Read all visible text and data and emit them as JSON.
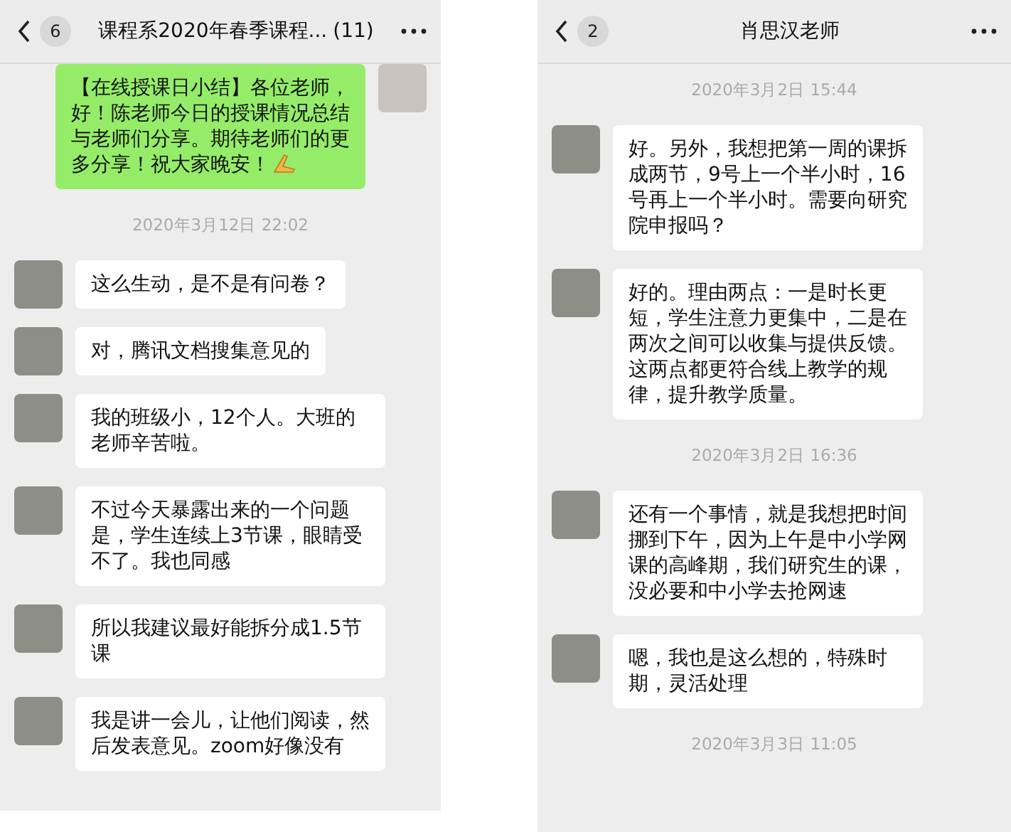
{
  "panels": [
    {
      "header": {
        "badge": "6",
        "title": "课程系2020年春季课程...",
        "count": "(11)"
      },
      "items": [
        {
          "kind": "sent",
          "text": "【在线授课日小结】各位老师，好！陈老师今日的授课情况总结与老师们分享。期待老师们的更多分享！祝大家晚安！"
        },
        {
          "kind": "time",
          "text": "2020年3月12日 22:02"
        },
        {
          "kind": "received",
          "text": "这么生动，是不是有问卷？"
        },
        {
          "kind": "received",
          "text": "对，腾讯文档搜集意见的"
        },
        {
          "kind": "received",
          "text": "我的班级小，12个人。大班的老师辛苦啦。"
        },
        {
          "kind": "received",
          "text": "不过今天暴露出来的一个问题是，学生连续上3节课，眼睛受不了。我也同感"
        },
        {
          "kind": "received",
          "text": "所以我建议最好能拆分成1.5节课"
        },
        {
          "kind": "received",
          "text": "我是讲一会儿，让他们阅读，然后发表意见。zoom好像没有"
        }
      ]
    },
    {
      "header": {
        "badge": "2",
        "title": "肖思汉老师"
      },
      "items": [
        {
          "kind": "time",
          "text": "2020年3月2日 15:44"
        },
        {
          "kind": "received",
          "text": "好。另外，我想把第一周的课拆成两节，9号上一个半小时，16号再上一个半小时。需要向研究院申报吗？"
        },
        {
          "kind": "received",
          "text": "好的。理由两点：一是时长更短，学生注意力更集中，二是在两次之间可以收集与提供反馈。这两点都更符合线上教学的规律，提升教学质量。"
        },
        {
          "kind": "time",
          "text": "2020年3月2日 16:36"
        },
        {
          "kind": "received",
          "text": "还有一个事情，就是我想把时间挪到下午，因为上午是中小学网课的高峰期，我们研究生的课，没必要和中小学去抢网速"
        },
        {
          "kind": "received",
          "text": "嗯，我也是这么想的，特殊时期，灵活处理"
        },
        {
          "kind": "time",
          "text": "2020年3月3日 11:05"
        }
      ]
    }
  ]
}
